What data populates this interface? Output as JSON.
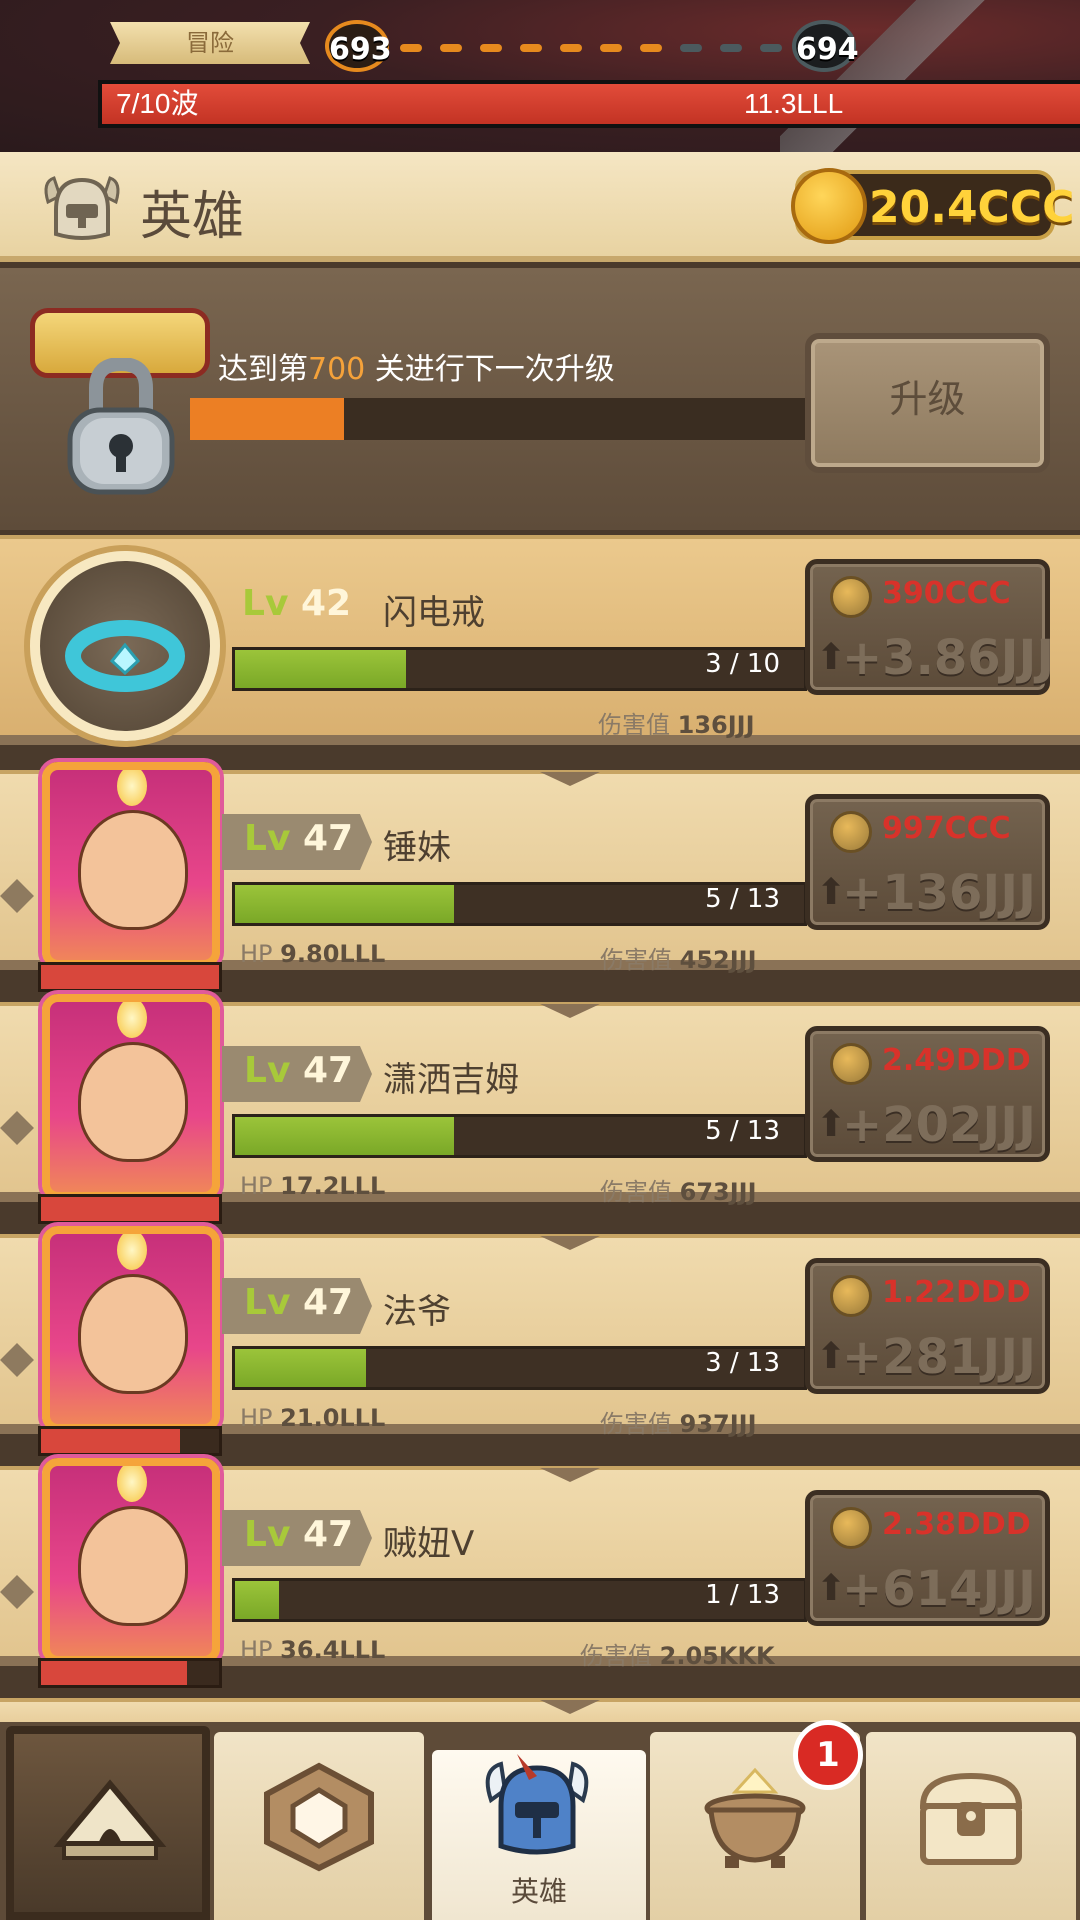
{
  "top": {
    "mode_label": "冒险",
    "current_level": "693",
    "next_level": "694",
    "wave_text": "7/10波",
    "enemy_hp": "11.3LLL",
    "wave_progress": 1.0
  },
  "header": {
    "title": "英雄",
    "gold": "20.4CCC"
  },
  "upgrade": {
    "text_prefix": "达到第",
    "text_level": "700",
    "text_suffix": " 关进行下一次升级",
    "button_label": "升级",
    "progress": 0.25
  },
  "artifact": {
    "lv_prefix": "Lv",
    "level": "42",
    "name": "闪电戒",
    "progress_text": "3 / 10",
    "progress": 0.3,
    "dmg_label": "伤害值",
    "dmg_value": "136JJJ",
    "cost": "390CCC",
    "gain": "+3.86JJJ"
  },
  "heroes": [
    {
      "lv_prefix": "Lv",
      "level": "47",
      "name": "锤妹",
      "progress_text": "5 / 13",
      "progress": 0.385,
      "hp_label": "HP",
      "hp_value": "9.80LLL",
      "hp_fill": 1.0,
      "dmg_label": "伤害值",
      "dmg_value": "452JJJ",
      "cost": "997CCC",
      "gain": "+136JJJ"
    },
    {
      "lv_prefix": "Lv",
      "level": "47",
      "name": "潇洒吉姆",
      "progress_text": "5 / 13",
      "progress": 0.385,
      "hp_label": "HP",
      "hp_value": "17.2LLL",
      "hp_fill": 1.0,
      "dmg_label": "伤害值",
      "dmg_value": "673JJJ",
      "cost": "2.49DDD",
      "gain": "+202JJJ"
    },
    {
      "lv_prefix": "Lv",
      "level": "47",
      "name": "法爷",
      "progress_text": "3 / 13",
      "progress": 0.23,
      "hp_label": "HP",
      "hp_value": "21.0LLL",
      "hp_fill": 0.78,
      "dmg_label": "伤害值",
      "dmg_value": "937JJJ",
      "cost": "1.22DDD",
      "gain": "+281JJJ"
    },
    {
      "lv_prefix": "Lv",
      "level": "47",
      "name": "贼妞V",
      "progress_text": "1 / 13",
      "progress": 0.077,
      "hp_label": "HP",
      "hp_value": "36.4LLL",
      "hp_fill": 0.82,
      "dmg_label": "伤害值",
      "dmg_value": "2.05KKK",
      "cost": "2.38DDD",
      "gain": "+614JJJ"
    }
  ],
  "nav": {
    "heroes_label": "英雄",
    "badge_count": "1"
  },
  "colors": {
    "cost_red": "#d8322a",
    "level_green": "#a8c93a",
    "progress_green": "#7aa827",
    "upgrade_orange": "#ec7f24",
    "gold_yellow": "#ffd23a"
  },
  "icons": {
    "header": "helmet-icon",
    "currency": "gold-coin-icon",
    "lock": "padlock-icon",
    "artifact": "ring-icon",
    "upgrade_arrow": "up-arrow-icon",
    "nav": [
      "tent-icon",
      "hexagon-rune-icon",
      "knight-helmet-icon",
      "cauldron-icon",
      "treasure-chest-icon"
    ]
  }
}
